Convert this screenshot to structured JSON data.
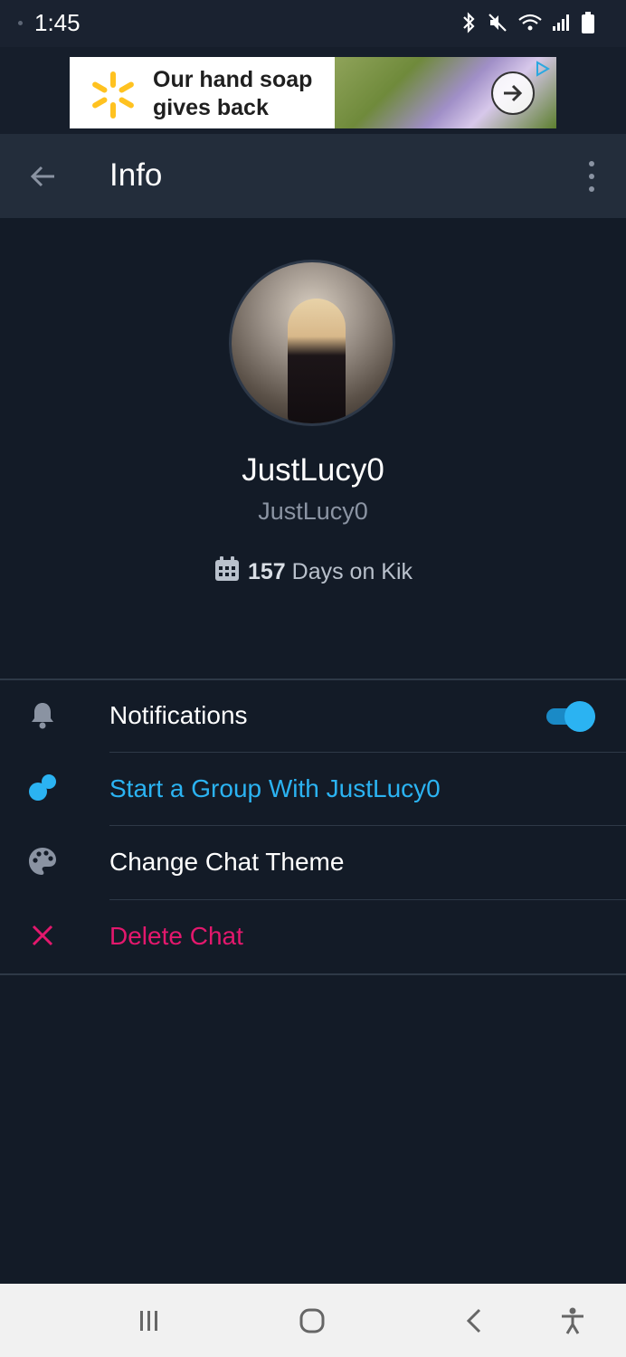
{
  "status_bar": {
    "time": "1:45"
  },
  "ad": {
    "text_line1": "Our hand soap",
    "text_line2": "gives back",
    "brand_color": "#ffc220"
  },
  "header": {
    "title": "Info"
  },
  "profile": {
    "display_name": "JustLucy0",
    "username": "JustLucy0",
    "days_count": "157",
    "days_suffix": " Days on Kik"
  },
  "menu": [
    {
      "label": "Notifications",
      "icon": "bell-icon",
      "color": "#ffffff",
      "toggle_on": true
    },
    {
      "label": "Start a Group With JustLucy0",
      "icon": "group-icon",
      "color": "#2bb3f2"
    },
    {
      "label": "Change Chat Theme",
      "icon": "palette-icon",
      "color": "#ffffff"
    },
    {
      "label": "Delete Chat",
      "icon": "close-icon",
      "color": "#e3186d"
    }
  ],
  "colors": {
    "background": "#131b27",
    "app_bar": "#232d3b",
    "accent_blue": "#2bb3f2",
    "danger_pink": "#e3186d"
  }
}
